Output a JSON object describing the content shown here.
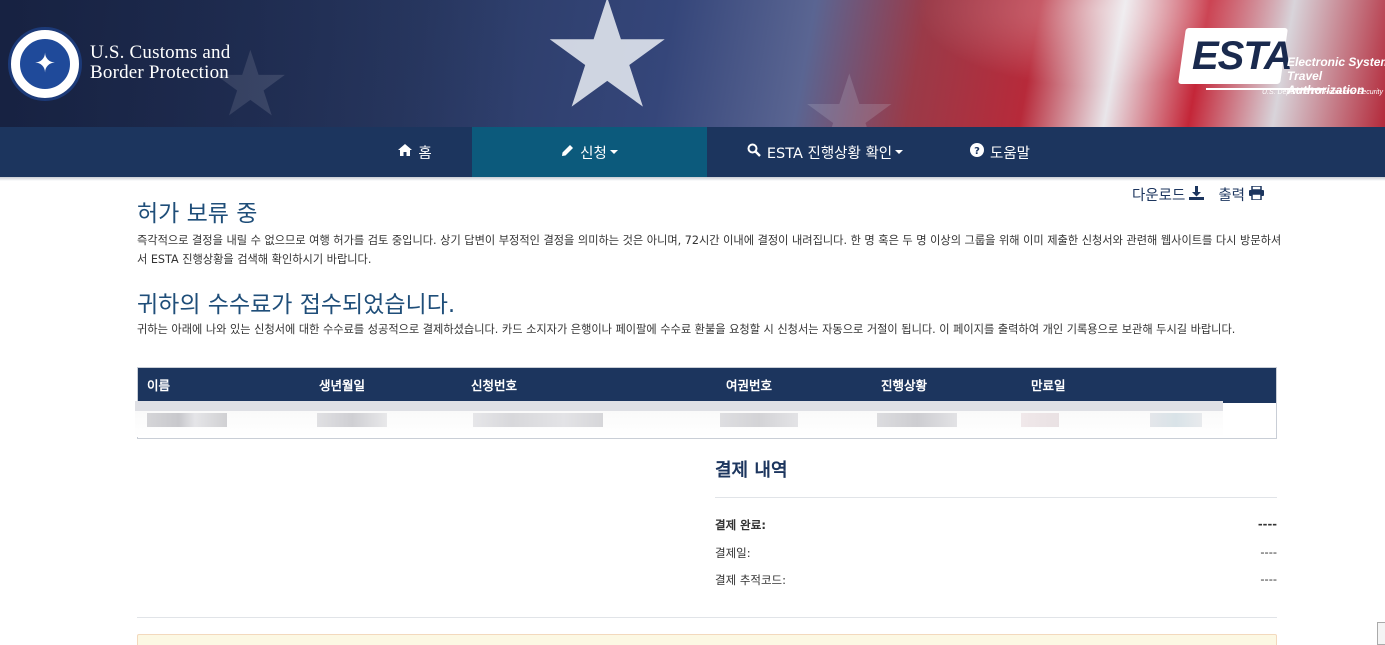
{
  "header": {
    "agency_name_line1": "U.S. Customs and",
    "agency_name_line2": "Border Protection",
    "seal_icon": "dhs-seal",
    "esta_logo": {
      "word": "ESTA",
      "subtitle_line1": "Electronic System",
      "subtitle_line2": "Travel Authorization",
      "department": "U.S. Department of Homeland Security"
    }
  },
  "nav": {
    "items": [
      {
        "label": "홈",
        "icon": "home-icon"
      },
      {
        "label": "신청",
        "icon": "pencil-icon",
        "dropdown": true,
        "active": true
      },
      {
        "label": "ESTA 진행상황 확인",
        "icon": "search-icon",
        "dropdown": true
      },
      {
        "label": "도움말",
        "icon": "question-circle-icon"
      }
    ]
  },
  "actions": {
    "download_label": "다운로드",
    "print_label": "출력"
  },
  "pending": {
    "title": "허가 보류 중",
    "body": "즉각적으로 결정을 내릴 수 없으므로 여행 허가를 검토 중입니다. 상기 답변이 부정적인 결정을 의미하는 것은 아니며, 72시간 이내에 결정이 내려집니다. 한 명 혹은 두 명 이상의 그룹을 위해 이미 제출한 신청서와 관련해 웹사이트를 다시 방문하셔서 ESTA 진행상황을 검색해 확인하시기 바랍니다."
  },
  "fee": {
    "title": "귀하의 수수료가 접수되었습니다.",
    "body": "귀하는 아래에 나와 있는 신청서에 대한 수수료를 성공적으로 결제하셨습니다. 카드 소지자가 은행이나 페이팔에 수수료 환불을 요청할 시 신청서는 자동으로 거절이 됩니다. 이 페이지를 출력하여 개인 기록용으로 보관해 두시길 바랍니다."
  },
  "table": {
    "columns": [
      "이름",
      "생년월일",
      "신청번호",
      "여권번호",
      "진행상황",
      "만료일"
    ]
  },
  "payment": {
    "title": "결제 내역",
    "rows": [
      {
        "label": "결제 완료:",
        "value": "----"
      },
      {
        "label": "결제일:",
        "value": "----"
      },
      {
        "label": "결제 추적코드:",
        "value": "----"
      }
    ]
  },
  "colors": {
    "navbar": "#1c355e",
    "nav_active": "#0c5a7c",
    "heading": "#1f4e79"
  }
}
